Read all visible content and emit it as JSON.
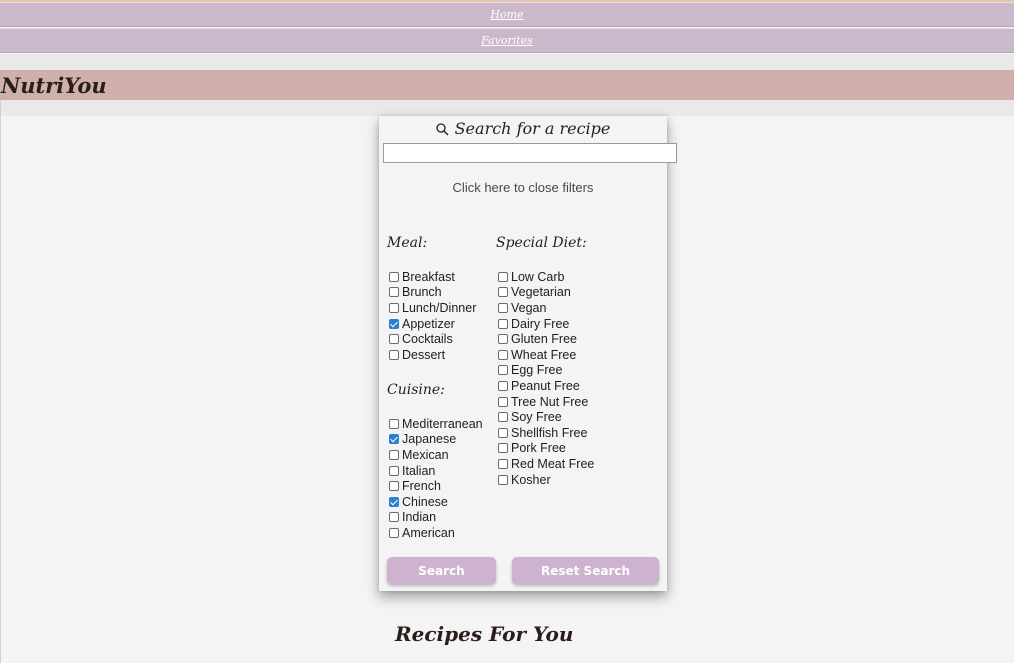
{
  "nav": {
    "home": "Home",
    "favorites": "Favorites"
  },
  "brand": "NutriYou",
  "search": {
    "title": "Search for a recipe",
    "placeholder": "",
    "close_filters": "Click here to close filters",
    "search_button": "Search",
    "reset_button": "Reset Search"
  },
  "filters": {
    "meal": {
      "heading": "Meal:",
      "options": [
        {
          "label": "Breakfast",
          "checked": false
        },
        {
          "label": "Brunch",
          "checked": false
        },
        {
          "label": "Lunch/Dinner",
          "checked": false
        },
        {
          "label": "Appetizer",
          "checked": true
        },
        {
          "label": "Cocktails",
          "checked": false
        },
        {
          "label": "Dessert",
          "checked": false
        }
      ]
    },
    "cuisine": {
      "heading": "Cuisine:",
      "options": [
        {
          "label": "Mediterranean",
          "checked": false
        },
        {
          "label": "Japanese",
          "checked": true
        },
        {
          "label": "Mexican",
          "checked": false
        },
        {
          "label": "Italian",
          "checked": false
        },
        {
          "label": "French",
          "checked": false
        },
        {
          "label": "Chinese",
          "checked": true
        },
        {
          "label": "Indian",
          "checked": false
        },
        {
          "label": "American",
          "checked": false
        }
      ]
    },
    "diet": {
      "heading": "Special Diet:",
      "options": [
        {
          "label": "Low Carb",
          "checked": false
        },
        {
          "label": "Vegetarian",
          "checked": false
        },
        {
          "label": "Vegan",
          "checked": false
        },
        {
          "label": "Dairy Free",
          "checked": false
        },
        {
          "label": "Gluten Free",
          "checked": false
        },
        {
          "label": "Wheat Free",
          "checked": false
        },
        {
          "label": "Egg Free",
          "checked": false
        },
        {
          "label": "Peanut Free",
          "checked": false
        },
        {
          "label": "Tree Nut Free",
          "checked": false
        },
        {
          "label": "Soy Free",
          "checked": false
        },
        {
          "label": "Shellfish Free",
          "checked": false
        },
        {
          "label": "Pork Free",
          "checked": false
        },
        {
          "label": "Red Meat Free",
          "checked": false
        },
        {
          "label": "Kosher",
          "checked": false
        }
      ]
    }
  },
  "recipes_heading": "Recipes For You",
  "colors": {
    "nav_bg": "#cbb8cb",
    "brand_bg": "#cfb0aa",
    "button_bg": "#cdb3cf",
    "checkbox_checked": "#2f7fd0",
    "page_bg": "#f4f4f4"
  }
}
